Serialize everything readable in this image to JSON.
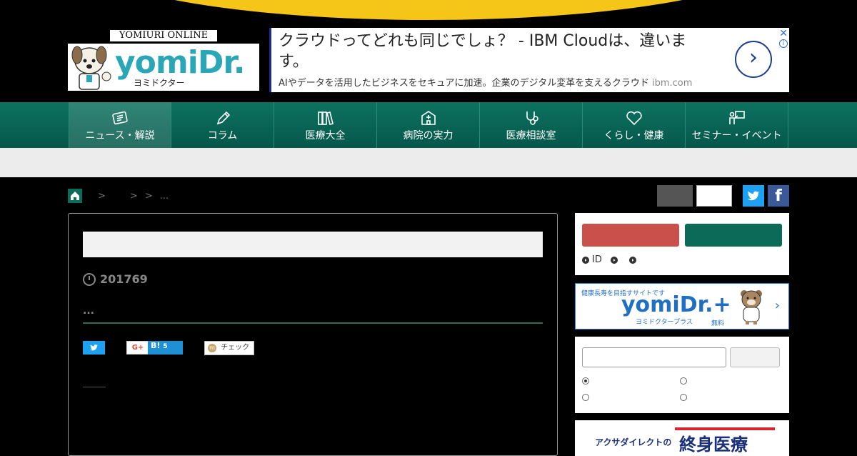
{
  "logo": {
    "online": "YOMIURI ONLINE",
    "main": "yomiDr.",
    "sub": "ヨミドクター"
  },
  "ad": {
    "title": "クラウドってどれも同じでしょ？ - IBM Cloudは、違います。",
    "description": "AIやデータを活用したビジネスをセキュアに加速。企業のデジタル変革を支えるクラウド",
    "domain": "ibm.com",
    "arrow": "›",
    "close": "✕",
    "info": "i"
  },
  "nav": {
    "items": [
      {
        "label": "ニュース・解説",
        "icon": "newspaper-icon"
      },
      {
        "label": "コラム",
        "icon": "pen-icon"
      },
      {
        "label": "医療大全",
        "icon": "books-icon"
      },
      {
        "label": "病院の実力",
        "icon": "hospital-icon"
      },
      {
        "label": "医療相談室",
        "icon": "stethoscope-icon"
      },
      {
        "label": "くらし・健康",
        "icon": "heart-icon"
      },
      {
        "label": "セミナー・イベント",
        "icon": "seminar-icon"
      }
    ]
  },
  "breadcrumb": {
    "sep1": ">",
    "sep2": ">",
    "sep3": ">",
    "ellipsis": "..."
  },
  "social": {
    "facebook": "f"
  },
  "article": {
    "date": "201769",
    "subtitle": "...",
    "share": {
      "gplus": "G+",
      "hatena": "B!",
      "hatena_count": "5",
      "mixi": "チェック",
      "mixi_mark": "m"
    }
  },
  "sidebar": {
    "login_links": [
      "ID",
      "",
      ""
    ],
    "banner": {
      "small": "健康長寿を目指すサイトです",
      "main": "yomiDr.+",
      "sub": "ヨミドクタープラス",
      "free": "無料",
      "arrow": "›"
    },
    "ad2": {
      "left": "アクサダイレクトの",
      "right": "終身医療"
    }
  }
}
